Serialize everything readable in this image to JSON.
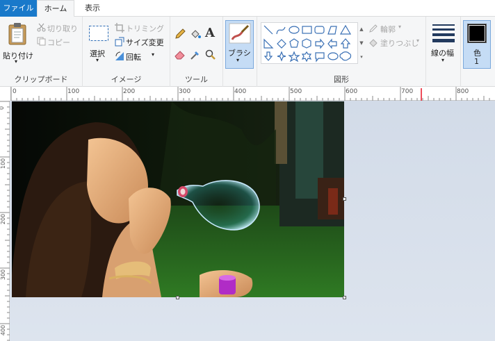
{
  "tabs": {
    "file": "ファイル",
    "home": "ホーム",
    "view": "表示"
  },
  "clipboard": {
    "paste": "貼り付け",
    "cut": "切り取り",
    "copy": "コピー",
    "label": "クリップボード"
  },
  "image": {
    "select": "選択",
    "crop": "トリミング",
    "resize": "サイズ変更",
    "rotate": "回転",
    "label": "イメージ"
  },
  "tools": {
    "label": "ツール",
    "text_glyph": "A"
  },
  "brushes": {
    "label": "ブラシ"
  },
  "shapes": {
    "outline": "輪郭",
    "fill": "塗りつぶし",
    "label": "図形"
  },
  "size": {
    "label": "線の幅"
  },
  "color1": {
    "label_line1": "色",
    "label_line2": "1",
    "value": "#000000"
  },
  "ruler": {
    "h_ticks": [
      "0",
      "100",
      "200",
      "300",
      "400",
      "500",
      "600",
      "700",
      "800"
    ],
    "v_ticks": [
      "0",
      "100",
      "200",
      "300",
      "400"
    ]
  },
  "colors": {
    "accent": "#1979ca",
    "selected": "#c5dcf5",
    "ruler_marker": "#e81123"
  }
}
